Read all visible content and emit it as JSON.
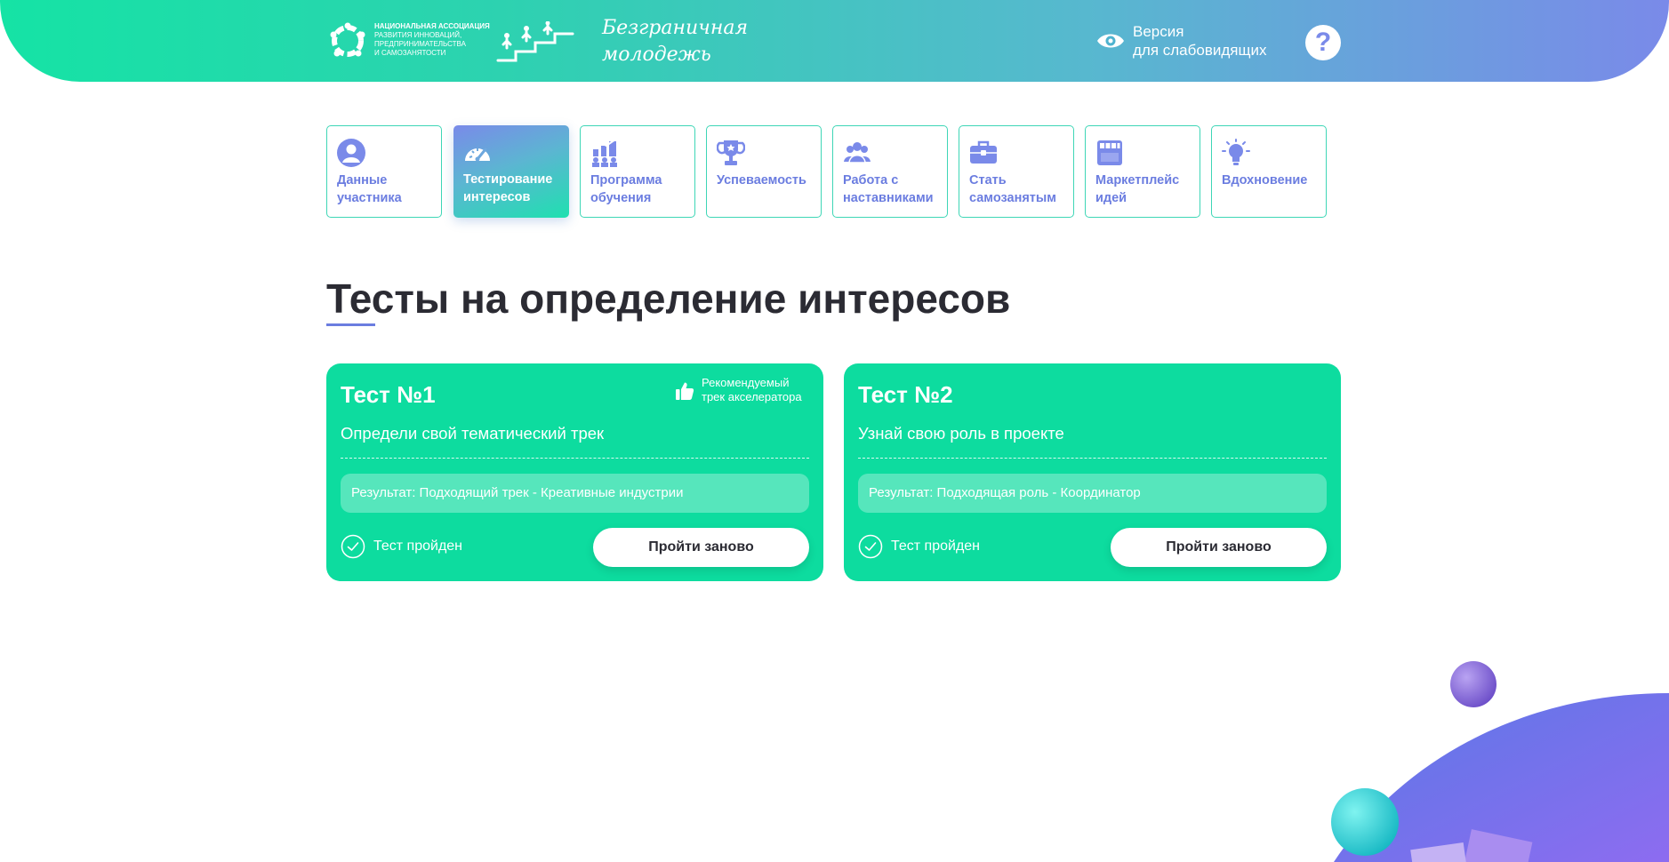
{
  "header": {
    "association_lines": [
      "Национальная ассоциация",
      "развития инноваций,",
      "предпринимательства",
      "и самозанятости"
    ],
    "brand_lines": [
      "Безграничная",
      "молодежь"
    ],
    "vision_lines": [
      "Версия",
      "для слабовидящих"
    ],
    "help_label": "?",
    "icons": {
      "logo": "association-logo-icon",
      "people": "people-stairs-icon",
      "eye": "eye-icon"
    }
  },
  "tabs": [
    {
      "lines": [
        "Данные",
        "участника"
      ],
      "icon": "user-icon",
      "active": false
    },
    {
      "lines": [
        "Тестирование",
        "интересов"
      ],
      "icon": "speedometer-icon",
      "active": true
    },
    {
      "lines": [
        "Программа",
        "обучения"
      ],
      "icon": "chart-growth-icon",
      "active": false
    },
    {
      "lines": [
        "Успеваемость"
      ],
      "icon": "trophy-icon",
      "active": false
    },
    {
      "lines": [
        "Работа с",
        "наставниками"
      ],
      "icon": "group-icon",
      "active": false
    },
    {
      "lines": [
        "Стать",
        "самозанятым"
      ],
      "icon": "briefcase-icon",
      "active": false
    },
    {
      "lines": [
        "Маркетплейс",
        "идей"
      ],
      "icon": "store-icon",
      "active": false
    },
    {
      "lines": [
        "Вдохновение"
      ],
      "icon": "lightbulb-icon",
      "active": false
    }
  ],
  "page_title": "Тесты на определение интересов",
  "cards": [
    {
      "title": "Тест №1",
      "description": "Определи свой тематический трек",
      "result": "Результат: Подходящий трек - Креативные индустрии",
      "status": "Тест пройден",
      "button": "Пройти заново",
      "recommend_lines": [
        "Рекомендуемый",
        "трек акселератора"
      ]
    },
    {
      "title": "Тест №2",
      "description": "Узнай свою роль в проекте",
      "result": "Результат: Подходящая роль - Координатор",
      "status": "Тест пройден",
      "button": "Пройти заново"
    }
  ],
  "colors": {
    "accent": "#6b7de0",
    "card": "#0ddc9f",
    "header_start": "#15e3a5",
    "header_end": "#7a8ae9"
  }
}
